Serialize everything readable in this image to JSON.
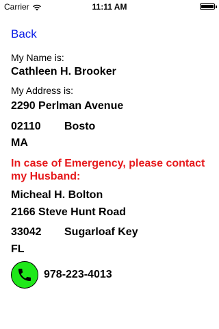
{
  "status_bar": {
    "carrier": "Carrier",
    "time": "11:11 AM"
  },
  "nav": {
    "back_label": "Back"
  },
  "owner": {
    "name_label": "My Name is:",
    "name": "Cathleen H. Brooker",
    "address_label": "My Address is:",
    "street": "2290 Perlman Avenue",
    "zip": "02110",
    "city": "Bosto",
    "state": "MA"
  },
  "emergency": {
    "notice": "In case of Emergency, please contact my Husband:",
    "contact_name": "Micheal H. Bolton",
    "street": "2166 Steve Hunt Road",
    "zip": "33042",
    "city": "Sugarloaf Key",
    "state": "FL",
    "phone": "978-223-4013",
    "phone_icon": "phone-icon",
    "phone_icon_color": "#1fe81a"
  },
  "colors": {
    "link": "#0a1de6",
    "alert": "#e6191c"
  }
}
